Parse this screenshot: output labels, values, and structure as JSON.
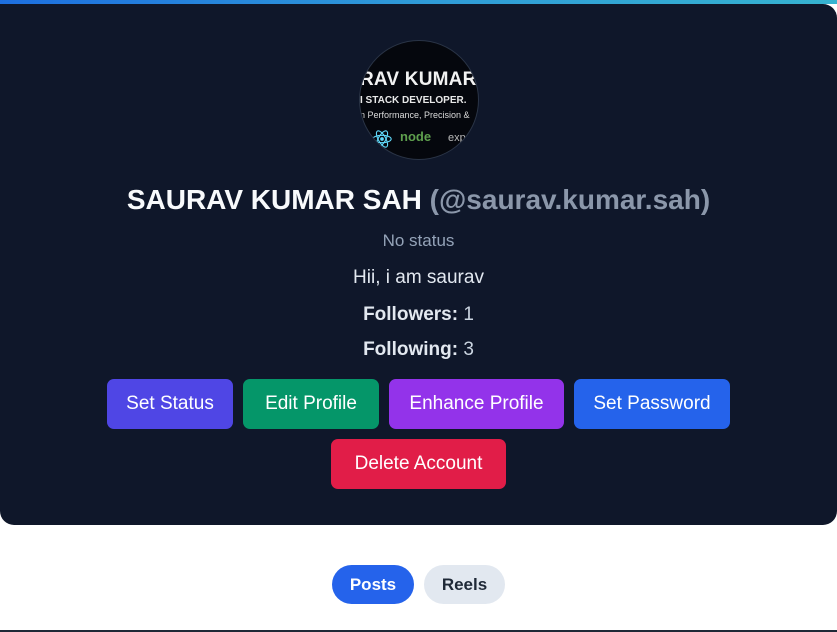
{
  "colors": {
    "card_bg": "#0f172a",
    "set_status": "#4f46e5",
    "edit_profile": "#059669",
    "enhance_profile": "#9333ea",
    "set_password": "#2563eb",
    "delete_account": "#e11d48",
    "tab_active": "#2563eb",
    "tab_inactive": "#e2e8f0"
  },
  "profile": {
    "avatar_text": {
      "line1": "RAV KUMAR",
      "line2": "I STACK DEVELOPER.",
      "line3": "n Performance, Precision &",
      "node": "node",
      "exp": "exp"
    },
    "name": "SAURAV KUMAR SAH",
    "handle": "(@saurav.kumar.sah)",
    "status": "No status",
    "bio": "Hii, i am saurav",
    "followers_label": "Followers:",
    "followers_count": "1",
    "following_label": "Following:",
    "following_count": "3"
  },
  "actions": {
    "set_status": "Set Status",
    "edit_profile": "Edit Profile",
    "enhance_profile": "Enhance Profile",
    "set_password": "Set Password",
    "delete_account": "Delete Account"
  },
  "tabs": {
    "posts": "Posts",
    "reels": "Reels"
  }
}
